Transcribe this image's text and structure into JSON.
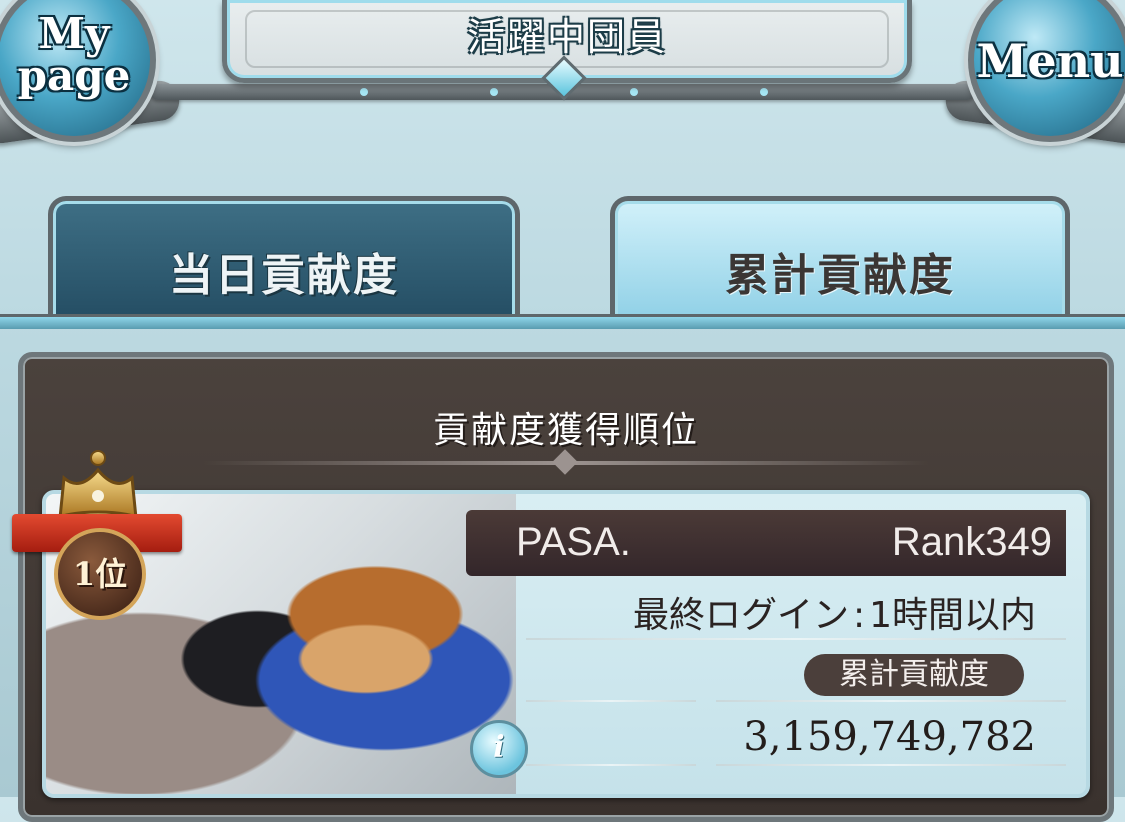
{
  "header": {
    "title": "活躍中団員",
    "mypage_line1": "My",
    "mypage_line2": "page",
    "menu_label": "Menu"
  },
  "tabs": [
    {
      "label": "当日貢献度",
      "active": false
    },
    {
      "label": "累計貢献度",
      "active": true
    }
  ],
  "panel": {
    "title": "貢献度獲得順位"
  },
  "member": {
    "place": "1位",
    "name": "PASA.",
    "rank": "Rank349",
    "login_label": "最終ログイン",
    "login_sep": ":",
    "login_value": "1時間以内",
    "total_label": "累計貢献度",
    "total_value": "3,159,749,782",
    "info_icon": "i"
  },
  "colors": {
    "accent_blue": "#8fd0e6",
    "panel_brown": "#3a322e",
    "badge_brown": "#4b3f3b",
    "ribbon_red": "#c3301d",
    "crown_gold": "#d4a55a"
  },
  "icons": {
    "mypage": "mypage-round-button",
    "menu": "menu-round-button",
    "crown": "crown-icon",
    "info": "info-icon"
  }
}
